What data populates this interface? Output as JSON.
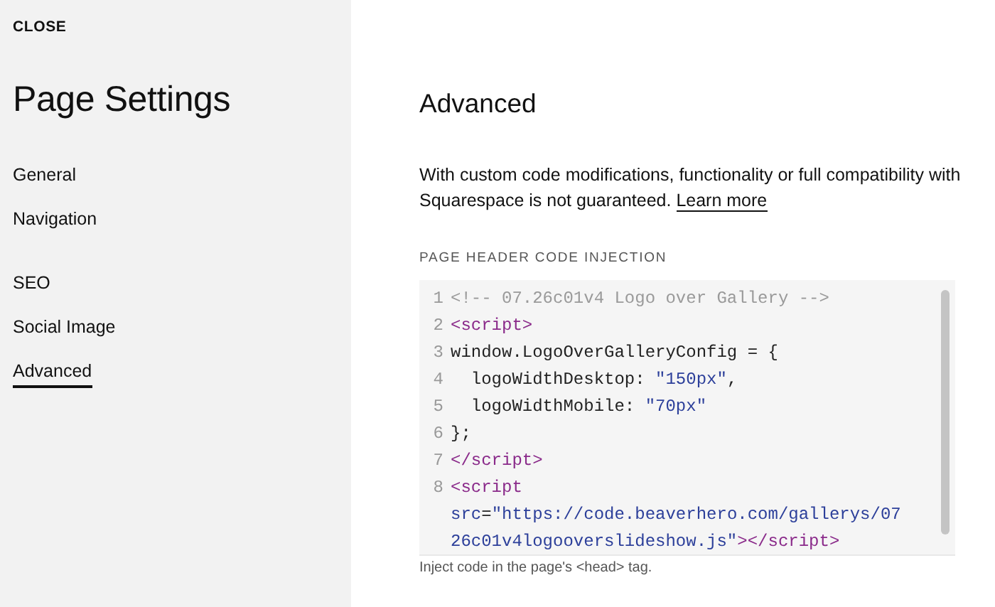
{
  "sidebar": {
    "close": "CLOSE",
    "title": "Page Settings",
    "groups": [
      {
        "items": [
          {
            "label": "General",
            "selected": false
          },
          {
            "label": "Navigation",
            "selected": false
          }
        ]
      },
      {
        "items": [
          {
            "label": "SEO",
            "selected": false
          },
          {
            "label": "Social Image",
            "selected": false
          },
          {
            "label": "Advanced",
            "selected": true
          }
        ]
      }
    ]
  },
  "main": {
    "title": "Advanced",
    "notice": "With custom code modifications, functionality or full compatibility with Squarespace is not guaranteed.",
    "notice_link": "Learn more",
    "code_injection": {
      "label": "PAGE HEADER CODE INJECTION",
      "lines": [
        {
          "number": "1",
          "rows": [
            {
              "tokens": [
                {
                  "kind": "comment",
                  "text": "<!-- 07.26c01v4 Logo over Gallery -->"
                }
              ]
            }
          ]
        },
        {
          "number": "2",
          "rows": [
            {
              "tokens": [
                {
                  "kind": "tag",
                  "text": "<script>"
                }
              ]
            }
          ]
        },
        {
          "number": "3",
          "rows": [
            {
              "tokens": [
                {
                  "kind": "plain",
                  "text": "window.LogoOverGalleryConfig = {"
                }
              ]
            }
          ]
        },
        {
          "number": "4",
          "rows": [
            {
              "tokens": [
                {
                  "kind": "plain",
                  "text": "  logoWidthDesktop: "
                },
                {
                  "kind": "string",
                  "text": "\"150px\""
                },
                {
                  "kind": "plain",
                  "text": ","
                }
              ]
            }
          ]
        },
        {
          "number": "5",
          "rows": [
            {
              "tokens": [
                {
                  "kind": "plain",
                  "text": "  logoWidthMobile: "
                },
                {
                  "kind": "string",
                  "text": "\"70px\""
                }
              ]
            }
          ]
        },
        {
          "number": "6",
          "rows": [
            {
              "tokens": [
                {
                  "kind": "plain",
                  "text": "};"
                }
              ]
            }
          ]
        },
        {
          "number": "7",
          "rows": [
            {
              "tokens": [
                {
                  "kind": "tag",
                  "text": "</script>"
                }
              ]
            }
          ]
        },
        {
          "number": "8",
          "rows": [
            {
              "tokens": [
                {
                  "kind": "tag",
                  "text": "<script"
                }
              ]
            },
            {
              "tokens": [
                {
                  "kind": "attr",
                  "text": "src"
                },
                {
                  "kind": "plain",
                  "text": "="
                },
                {
                  "kind": "string",
                  "text": "\"https://code.beaverhero.com/gallerys/07"
                }
              ]
            },
            {
              "tokens": [
                {
                  "kind": "string",
                  "text": "26c01v4logooverslideshow.js\""
                },
                {
                  "kind": "tag",
                  "text": "></script>"
                }
              ]
            }
          ]
        }
      ],
      "hint": "Inject code in the page's <head> tag."
    }
  }
}
